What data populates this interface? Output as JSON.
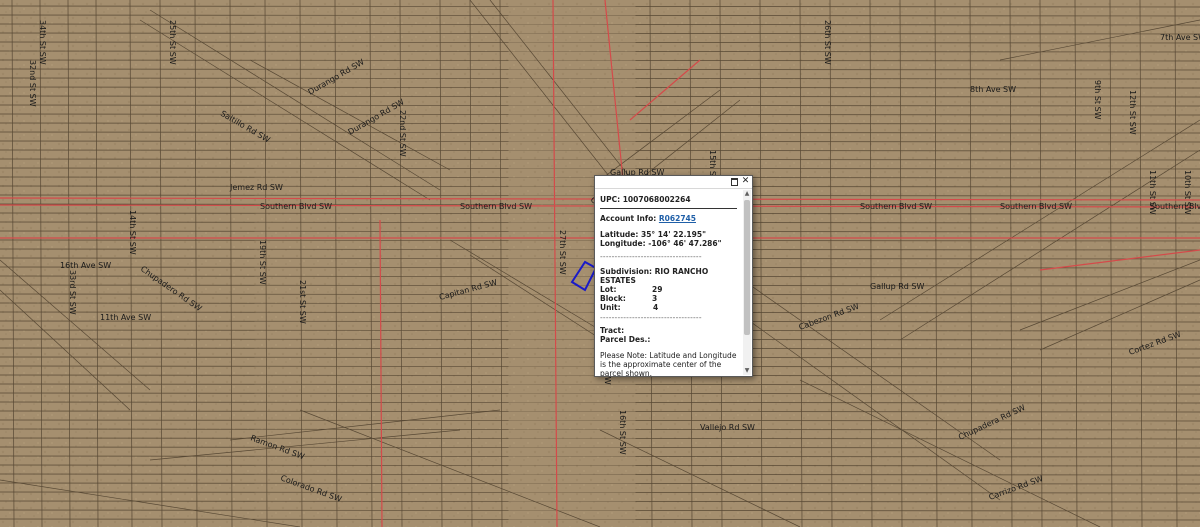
{
  "colors": {
    "terrain": "#a58f6f",
    "parcel_line": "#4a3c2a",
    "major_road": "#d44a4a",
    "selected_parcel": "#1a1ac8"
  },
  "road_labels": [
    "Southern Blvd SW",
    "Southern Blvd SW",
    "Southern Blvd SW",
    "Southern Blvd SW",
    "Southern Blvd",
    "Durango Rd SW",
    "Durango Rd SW",
    "Saltillo Rd SW",
    "Cuba Rd SW",
    "Gallup Rd SW",
    "Gallup Rd SW",
    "Cabezon Rd SW",
    "Capitan Rd SW",
    "Ramon Rd SW",
    "Colorado Rd SW",
    "Chupadero Rd SW",
    "Chupadera Rd SW",
    "Cortez Rd SW",
    "Jemez Rd SW",
    "Vallejo Rd SW",
    "Carrizo Rd SW",
    "16th Ave SW",
    "11th Ave SW",
    "8th Ave SW",
    "7th Ave SW",
    "14th St SW",
    "19th St SW",
    "21st St SW",
    "22nd St SW",
    "27th St SW",
    "32nd St SW",
    "33rd St SW",
    "34th St SW",
    "25th St SW",
    "26th St SW",
    "15th St SW",
    "16th St SW",
    "17th St SW",
    "12th St SW",
    "11th St SW",
    "10th St SW",
    "9th St SW"
  ],
  "popup": {
    "upc": "UPC: 1007068002264",
    "account_label": "Account Info:",
    "account_link": "R062745",
    "latitude": "Latitude: 35° 14' 22.195\"",
    "longitude": "Longitude: -106° 46' 47.286\"",
    "dashes": "-----------------------------------",
    "subdivision": "Subdivision: RIO RANCHO ESTATES",
    "lot_label": "Lot:",
    "lot_value": "29",
    "block_label": "Block:",
    "block_value": "3",
    "unit_label": "Unit:",
    "unit_value": "4",
    "tract": "Tract:",
    "parcel_des": "Parcel Des.:",
    "note": "Please Note: Latitude and Longitude is the approximate center of the parcel shown.",
    "maximize_icon": "maximize-icon",
    "close_icon": "close-icon",
    "close_glyph": "✕"
  }
}
